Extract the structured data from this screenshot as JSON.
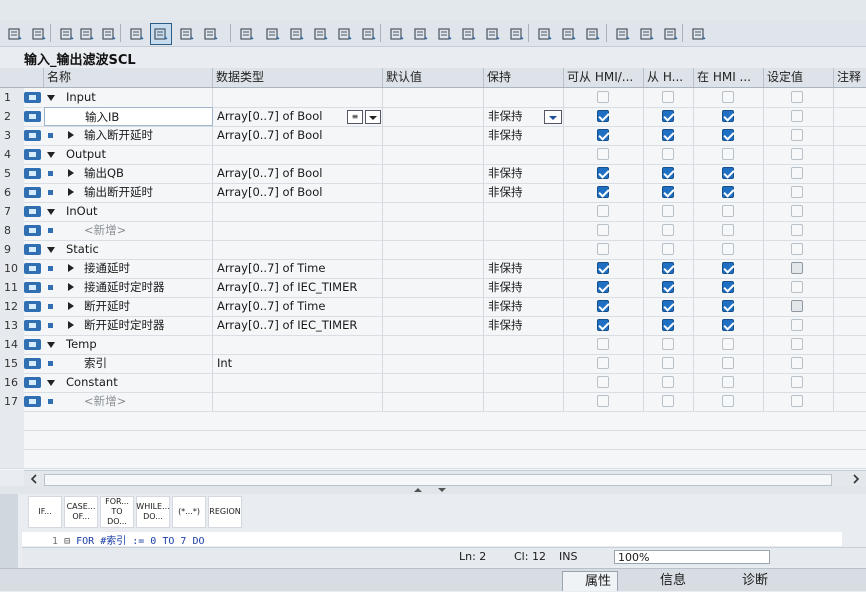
{
  "block_title": "输入_输出滤波SCL",
  "columns": [
    "名称",
    "数据类型",
    "默认值",
    "保持",
    "可从 HMI/...",
    "从 H...",
    "在 HMI ...",
    "设定值",
    "注释"
  ],
  "rows": [
    {
      "num": "1",
      "kind": "section",
      "name": "Input",
      "type": "",
      "retain": "",
      "c1": 0,
      "c2": 0,
      "c3": 0,
      "c4": 0
    },
    {
      "num": "2",
      "kind": "child",
      "name": "输入IB",
      "type": "Array[0..7] of Bool",
      "retain": "非保持",
      "c1": 1,
      "c2": 1,
      "c3": 1,
      "c4": 0,
      "selected": true
    },
    {
      "num": "3",
      "kind": "child",
      "name": "输入断开延时",
      "type": "Array[0..7] of Bool",
      "retain": "非保持",
      "c1": 1,
      "c2": 1,
      "c3": 1,
      "c4": 0
    },
    {
      "num": "4",
      "kind": "section",
      "name": "Output",
      "type": "",
      "retain": "",
      "c1": 0,
      "c2": 0,
      "c3": 0,
      "c4": 0
    },
    {
      "num": "5",
      "kind": "child",
      "name": "输出QB",
      "type": "Array[0..7] of Bool",
      "retain": "非保持",
      "c1": 1,
      "c2": 1,
      "c3": 1,
      "c4": 0
    },
    {
      "num": "6",
      "kind": "child",
      "name": "输出断开延时",
      "type": "Array[0..7] of Bool",
      "retain": "非保持",
      "c1": 1,
      "c2": 1,
      "c3": 1,
      "c4": 0
    },
    {
      "num": "7",
      "kind": "section",
      "name": "InOut",
      "type": "",
      "retain": "",
      "c1": 0,
      "c2": 0,
      "c3": 0,
      "c4": 0
    },
    {
      "num": "8",
      "kind": "new",
      "name": "<新增>",
      "type": "",
      "retain": "",
      "c1": 0,
      "c2": 0,
      "c3": 0,
      "c4": 0
    },
    {
      "num": "9",
      "kind": "section",
      "name": "Static",
      "type": "",
      "retain": "",
      "c1": 0,
      "c2": 0,
      "c3": 0,
      "c4": 0
    },
    {
      "num": "10",
      "kind": "child",
      "name": "接通延时",
      "type": "Array[0..7] of Time",
      "retain": "非保持",
      "c1": 1,
      "c2": 1,
      "c3": 1,
      "c4": 2
    },
    {
      "num": "11",
      "kind": "child",
      "name": "接通延时定时器",
      "type": "Array[0..7] of IEC_TIMER",
      "retain": "非保持",
      "c1": 1,
      "c2": 1,
      "c3": 1,
      "c4": 0
    },
    {
      "num": "12",
      "kind": "child",
      "name": "断开延时",
      "type": "Array[0..7] of Time",
      "retain": "非保持",
      "c1": 1,
      "c2": 1,
      "c3": 1,
      "c4": 2
    },
    {
      "num": "13",
      "kind": "child",
      "name": "断开延时定时器",
      "type": "Array[0..7] of IEC_TIMER",
      "retain": "非保持",
      "c1": 1,
      "c2": 1,
      "c3": 1,
      "c4": 0
    },
    {
      "num": "14",
      "kind": "section",
      "name": "Temp",
      "type": "",
      "retain": "",
      "c1": 0,
      "c2": 0,
      "c3": 0,
      "c4": 0
    },
    {
      "num": "15",
      "kind": "leaf",
      "name": "索引",
      "type": "Int",
      "retain": "",
      "c1": 0,
      "c2": 0,
      "c3": 0,
      "c4": 0
    },
    {
      "num": "16",
      "kind": "section",
      "name": "Constant",
      "type": "",
      "retain": "",
      "c1": 0,
      "c2": 0,
      "c3": 0,
      "c4": 0
    },
    {
      "num": "17",
      "kind": "new",
      "name": "<新增>",
      "type": "",
      "retain": "",
      "c1": 0,
      "c2": 0,
      "c3": 0,
      "c4": 0
    }
  ],
  "instructions": [
    "IF...",
    "CASE... OF...",
    "FOR... TO DO...",
    "WHILE... DO...",
    "(*...*)",
    "REGION"
  ],
  "code_line": {
    "num": "1",
    "text": "FOR #索引 := 0 TO 7 DO"
  },
  "status": {
    "ln": "Ln: 2",
    "cl": "Cl: 12",
    "mode": "INS",
    "zoom": "100%"
  },
  "bottom_tabs": [
    "属性",
    "信息",
    "诊断"
  ],
  "colors": {
    "accent": "#1f6fc2",
    "header": "#dde3e9"
  }
}
